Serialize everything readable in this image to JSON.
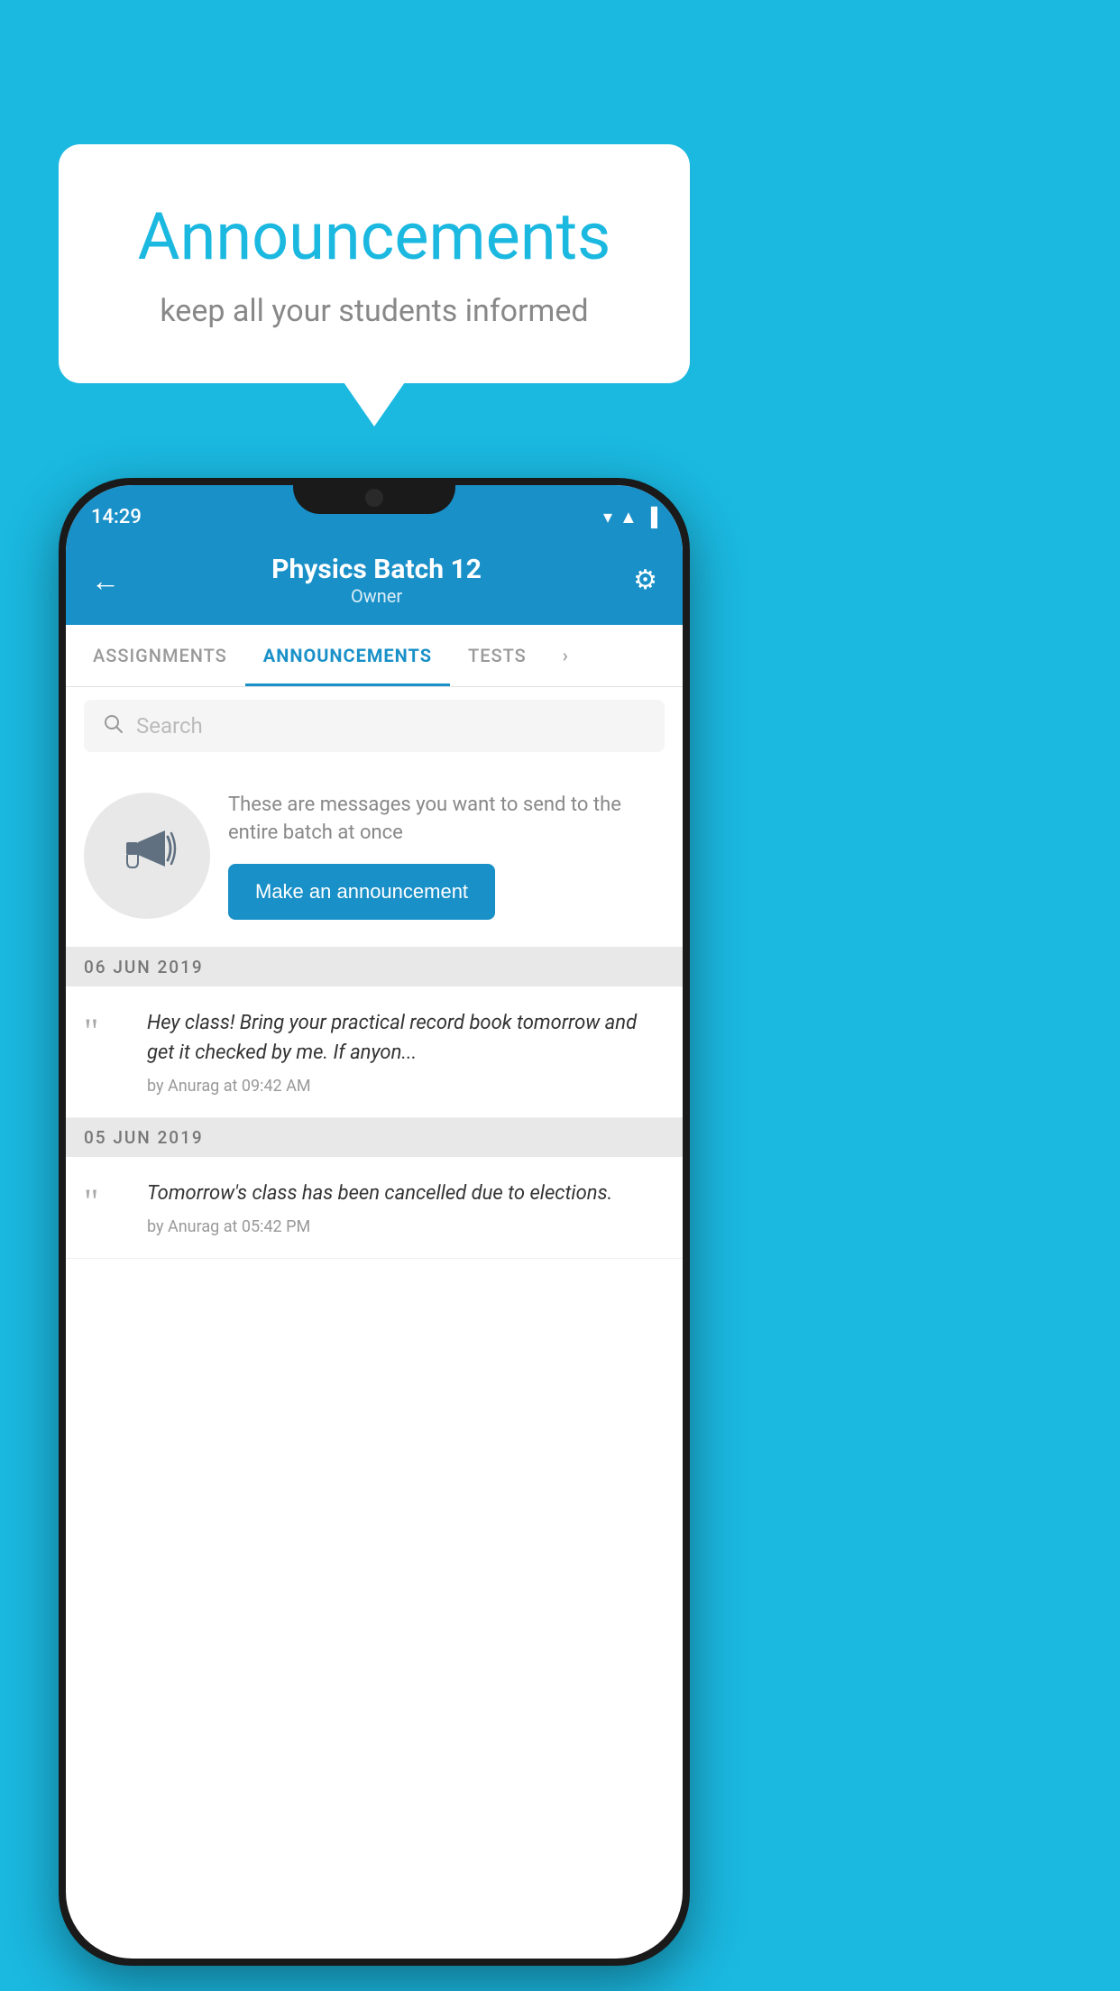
{
  "background_color": "#1BB8E0",
  "speech_bubble": {
    "title": "Announcements",
    "subtitle": "keep all your students informed"
  },
  "phone": {
    "status_bar": {
      "time": "14:29",
      "wifi": "▼",
      "signal": "▲",
      "battery": "▐"
    },
    "header": {
      "title": "Physics Batch 12",
      "subtitle": "Owner",
      "back_label": "←",
      "gear_label": "⚙"
    },
    "tabs": [
      {
        "label": "ASSIGNMENTS",
        "active": false
      },
      {
        "label": "ANNOUNCEMENTS",
        "active": true
      },
      {
        "label": "TESTS",
        "active": false
      },
      {
        "label": "›",
        "active": false
      }
    ],
    "search": {
      "placeholder": "Search"
    },
    "announcement_cta": {
      "description": "These are messages you want to send to the entire batch at once",
      "button_label": "Make an announcement"
    },
    "announcements": [
      {
        "date": "06  JUN  2019",
        "items": [
          {
            "text": "Hey class! Bring your practical record book tomorrow and get it checked by me. If anyon...",
            "author": "by Anurag at 09:42 AM"
          }
        ]
      },
      {
        "date": "05  JUN  2019",
        "items": [
          {
            "text": "Tomorrow's class has been cancelled due to elections.",
            "author": "by Anurag at 05:42 PM"
          }
        ]
      }
    ]
  }
}
